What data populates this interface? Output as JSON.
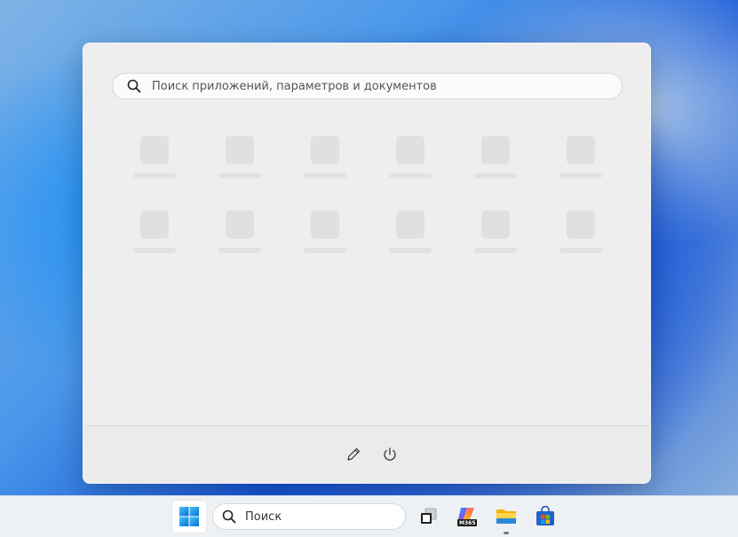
{
  "start_menu": {
    "search_placeholder": "Поиск приложений, параметров и документов",
    "placeholder_tiles": [
      {
        "row": 0,
        "col": 0
      },
      {
        "row": 0,
        "col": 1
      },
      {
        "row": 0,
        "col": 2
      },
      {
        "row": 0,
        "col": 3
      },
      {
        "row": 0,
        "col": 4
      },
      {
        "row": 0,
        "col": 5
      },
      {
        "row": 1,
        "col": 0
      },
      {
        "row": 1,
        "col": 1
      },
      {
        "row": 1,
        "col": 2
      },
      {
        "row": 1,
        "col": 3
      },
      {
        "row": 1,
        "col": 4
      },
      {
        "row": 1,
        "col": 5
      }
    ],
    "footer": {
      "edit_icon": "pencil-icon",
      "power_icon": "power-icon"
    }
  },
  "taskbar": {
    "search_label": "Поиск",
    "m365_badge": "M365",
    "items": [
      "start-icon",
      "task-view-icon",
      "copilot-m365-icon",
      "file-explorer-icon",
      "store-icon"
    ]
  },
  "colors": {
    "menu_bg": "#eeeeee",
    "placeholder": "#e0e0e0",
    "taskbar_bg": "#eef1f4",
    "accent": "#0f6cbd"
  }
}
